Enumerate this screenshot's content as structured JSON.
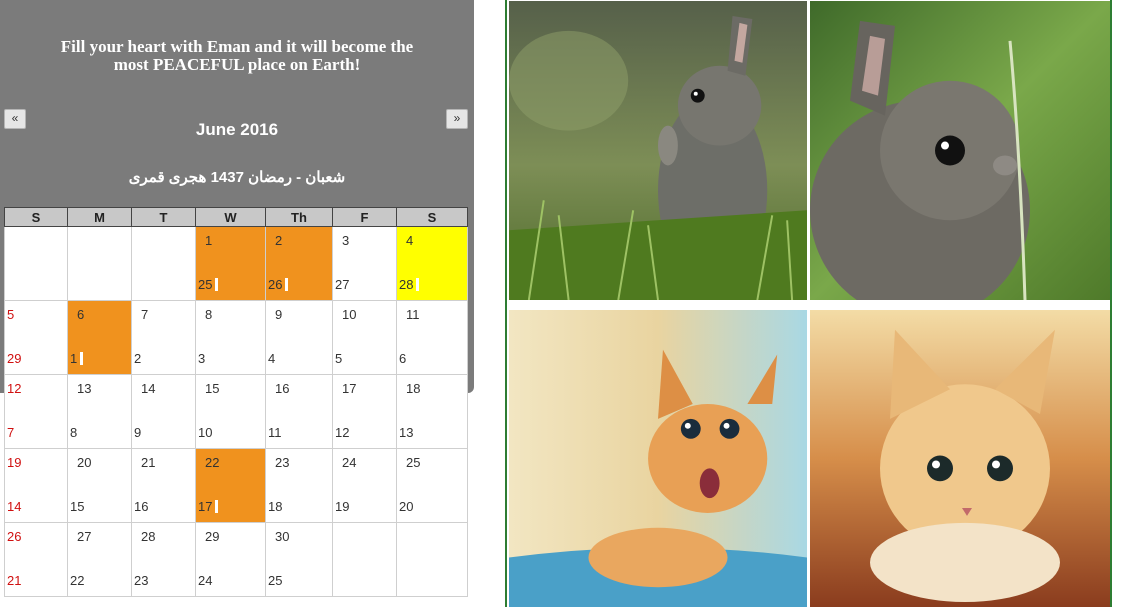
{
  "quote": {
    "line1": "Fill your heart with Eman and it will become the",
    "line2": "most PEACEFUL place on Earth!"
  },
  "nav": {
    "prev": "«",
    "next": "»"
  },
  "calendar": {
    "month_title": "June 2016",
    "hijri_title": "شعبان - رمضان 1437 هجرى قمرى",
    "weekdays": [
      "S",
      "M",
      "T",
      "W",
      "Th",
      "F",
      "S"
    ],
    "weeks": [
      [
        {
          "g": "",
          "h": ""
        },
        {
          "g": "",
          "h": ""
        },
        {
          "g": "",
          "h": ""
        },
        {
          "g": "1",
          "h": "25",
          "hl": "orange",
          "mark": true
        },
        {
          "g": "2",
          "h": "26",
          "hl": "orange",
          "mark": true
        },
        {
          "g": "3",
          "h": "27"
        },
        {
          "g": "4",
          "h": "28",
          "hl": "yellow",
          "mark": true
        }
      ],
      [
        {
          "g": "5",
          "h": "29"
        },
        {
          "g": "6",
          "h": "1",
          "hl": "orange",
          "mark": true
        },
        {
          "g": "7",
          "h": "2"
        },
        {
          "g": "8",
          "h": "3"
        },
        {
          "g": "9",
          "h": "4"
        },
        {
          "g": "10",
          "h": "5"
        },
        {
          "g": "11",
          "h": "6"
        }
      ],
      [
        {
          "g": "12",
          "h": "7"
        },
        {
          "g": "13",
          "h": "8"
        },
        {
          "g": "14",
          "h": "9"
        },
        {
          "g": "15",
          "h": "10"
        },
        {
          "g": "16",
          "h": "11"
        },
        {
          "g": "17",
          "h": "12"
        },
        {
          "g": "18",
          "h": "13"
        }
      ],
      [
        {
          "g": "19",
          "h": "14"
        },
        {
          "g": "20",
          "h": "15"
        },
        {
          "g": "21",
          "h": "16"
        },
        {
          "g": "22",
          "h": "17",
          "hl": "orange",
          "mark": true
        },
        {
          "g": "23",
          "h": "18"
        },
        {
          "g": "24",
          "h": "19"
        },
        {
          "g": "25",
          "h": "20"
        }
      ],
      [
        {
          "g": "26",
          "h": "21"
        },
        {
          "g": "27",
          "h": "22"
        },
        {
          "g": "28",
          "h": "23"
        },
        {
          "g": "29",
          "h": "24"
        },
        {
          "g": "30",
          "h": "25"
        },
        {
          "g": "",
          "h": ""
        },
        {
          "g": "",
          "h": ""
        }
      ]
    ]
  },
  "colors": {
    "panel_bg": "#7b7b7b",
    "highlight_orange": "#f0921e",
    "highlight_yellow": "#ffff00",
    "sunday_red": "#d01010",
    "grid_border": "#2e7d32"
  },
  "photos": [
    {
      "name": "bunny-photo-1",
      "subject": "rabbit"
    },
    {
      "name": "bunny-photo-2",
      "subject": "rabbit"
    },
    {
      "name": "kitten-photo-1",
      "subject": "kitten"
    },
    {
      "name": "kitten-photo-2",
      "subject": "kitten"
    }
  ]
}
